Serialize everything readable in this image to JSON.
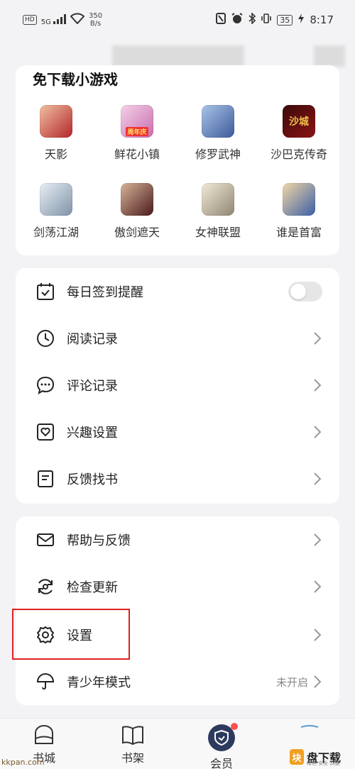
{
  "status_bar": {
    "hd_label": "HD",
    "signal_label": "5G",
    "speed_value": "350",
    "speed_unit": "B/s",
    "battery": "35",
    "time": "8:17"
  },
  "games": {
    "title": "免下载小游戏",
    "items": [
      {
        "name": "天影",
        "color": "#b3262b"
      },
      {
        "name": "鲜花小镇",
        "color": "#e58bb4",
        "badge": "周年庆"
      },
      {
        "name": "修罗武神",
        "color": "#3d5a9a"
      },
      {
        "name": "沙巴克传奇",
        "color": "#8b1414",
        "glyph": "沙城"
      },
      {
        "name": "剑荡江湖",
        "color": "#a8b8c8"
      },
      {
        "name": "傲剑遮天",
        "color": "#6a2a2a"
      },
      {
        "name": "女神联盟",
        "color": "#c9c2b0"
      },
      {
        "name": "谁是首富",
        "color": "#3a5fa6"
      }
    ]
  },
  "menu_group_1": {
    "checkin": "每日签到提醒",
    "history": "阅读记录",
    "comments": "评论记录",
    "interest": "兴趣设置",
    "feedback_book": "反馈找书"
  },
  "menu_group_2": {
    "help": "帮助与反馈",
    "update": "检查更新",
    "settings": "设置",
    "teen_mode": "青少年模式",
    "teen_mode_status": "未开启"
  },
  "tabs": {
    "store": "书城",
    "shelf": "书架",
    "member": "会员"
  },
  "watermark": {
    "site": "kkpan.com",
    "logo_text": "盘下载",
    "logo_mark": "块",
    "sub": "绿色·安全·高速"
  }
}
